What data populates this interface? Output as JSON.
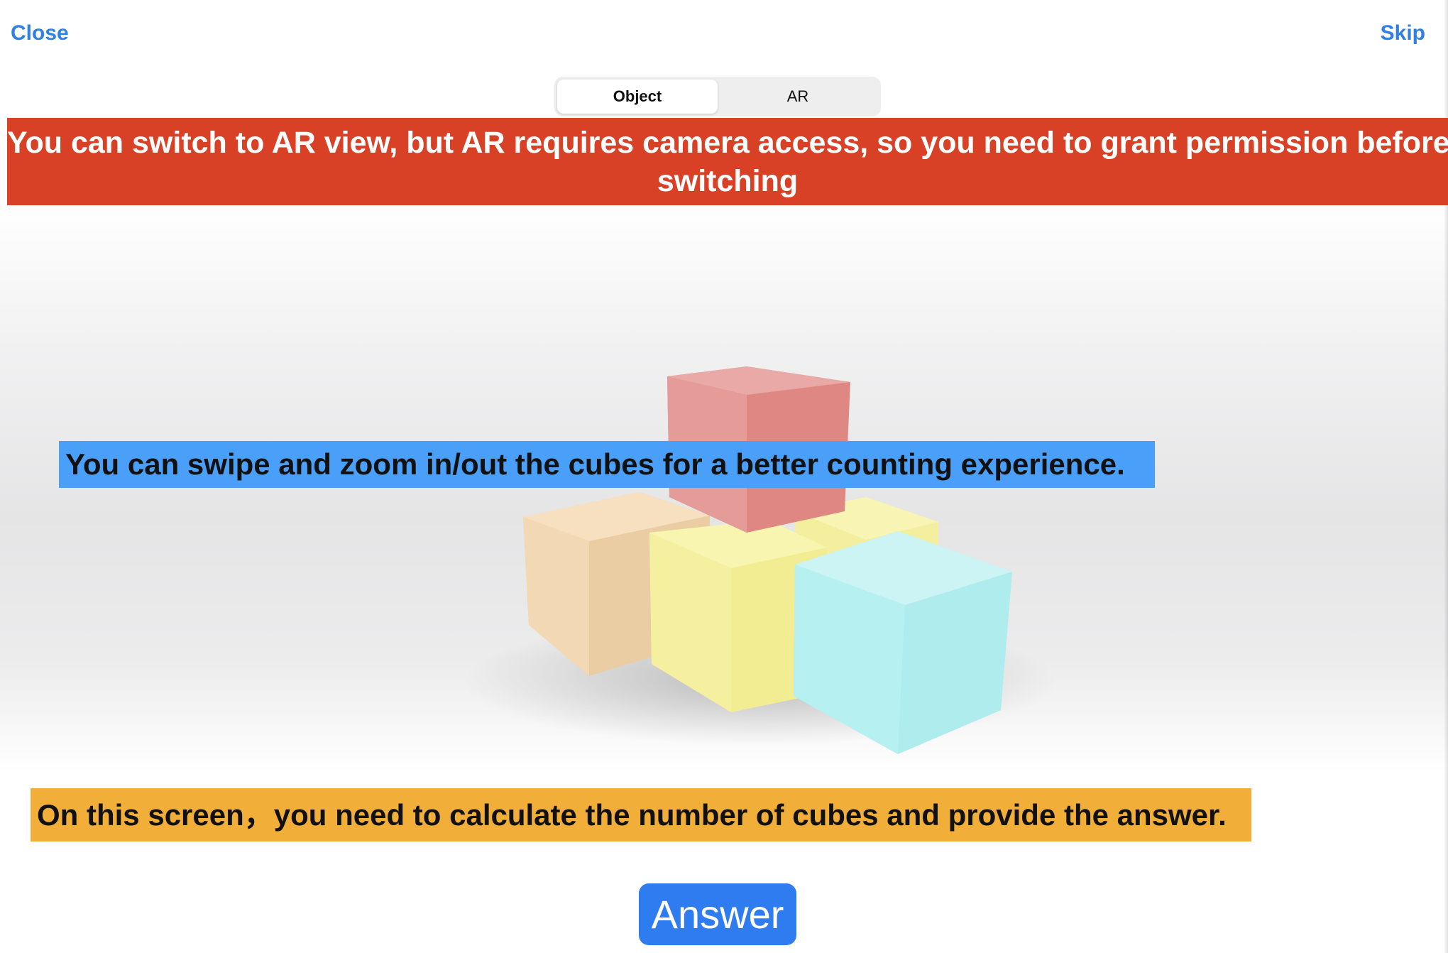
{
  "nav": {
    "close_label": "Close",
    "skip_label": "Skip"
  },
  "segmented_control": {
    "options": [
      "Object",
      "AR"
    ],
    "selected": "Object"
  },
  "banners": {
    "ar_notice_line1": "You can switch to AR view, but AR requires camera access, so you need to grant permission before",
    "ar_notice_line2": "switching",
    "swipe_hint": "You can swipe and zoom in/out the cubes for a better counting experience.",
    "count_instruction": "On this screen，you need to calculate the number of cubes and provide the answer."
  },
  "answer_button": {
    "label": "Answer"
  },
  "colors": {
    "link_blue": "#2f80e4",
    "banner_red": "#d84125",
    "hint_blue": "#4aa0f9",
    "hint_orange": "#f1ae38",
    "button_blue": "#2f7cf0",
    "cube_red": "#e38984",
    "cube_peach": "#f1d2a8",
    "cube_yellow": "#f4ef96",
    "cube_cyan": "#b0eef0"
  },
  "cubes": [
    "red-cube",
    "peach-cube",
    "yellow-cube-front",
    "yellow-cube-back",
    "cyan-cube"
  ]
}
